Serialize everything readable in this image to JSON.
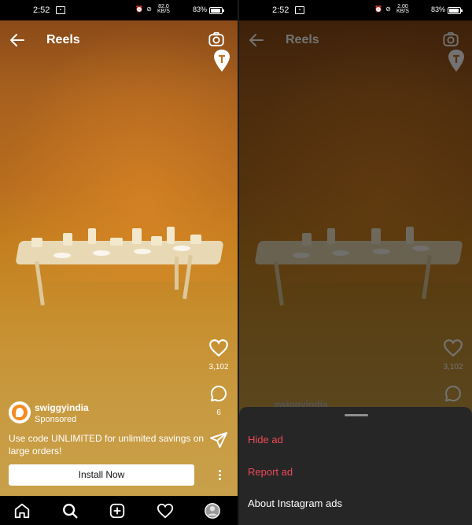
{
  "status": {
    "time": "2:52",
    "speed_left": "82.0",
    "speed_right": "2.00",
    "speed_unit": "KB/S",
    "battery": "83%"
  },
  "reels": {
    "title": "Reels"
  },
  "post": {
    "username": "swiggyindia",
    "username_partial": "swiggyindia",
    "sponsored": "Sponsored",
    "caption": "Use code UNLIMITED for unlimited savings on large orders!",
    "cta": "Install Now",
    "likes": "3,102",
    "comments": "6"
  },
  "sheet": {
    "items": [
      {
        "label": "Hide ad"
      },
      {
        "label": "Report ad"
      },
      {
        "label": "About Instagram ads"
      }
    ]
  },
  "colors": {
    "accent_danger": "#ed4956",
    "sheet_bg": "#262626",
    "brand_orange": "#f58a1f"
  }
}
